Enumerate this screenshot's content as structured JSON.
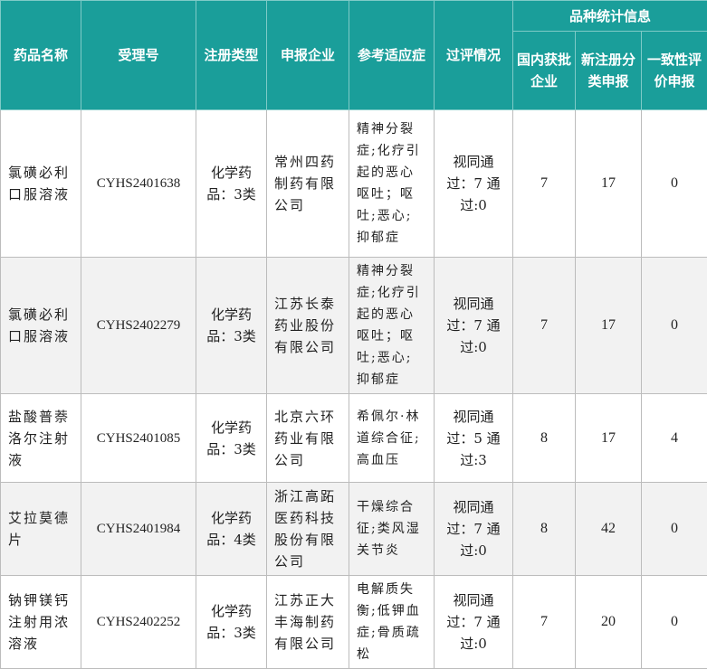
{
  "table": {
    "headers": {
      "drug_name": "药品名称",
      "acceptance_no": "受理号",
      "reg_type": "注册类型",
      "applicant": "申报企业",
      "indication": "参考适应症",
      "review": "过评情况",
      "stats_group": "品种统计信息",
      "domestic": "国内获批企业",
      "new_reg": "新注册分类申报",
      "consistency": "一致性评价申报"
    },
    "rows": [
      {
        "drug_name": "氯磺必利口服溶液",
        "acceptance_no": "CYHS2401638",
        "reg_type": "化学药品：3类",
        "applicant": "常州四药制药有限公司",
        "indication": "精神分裂症;化疗引起的恶心呕吐；呕吐;恶心;抑郁症",
        "review": "视同通过：7 通过:0",
        "domestic": "7",
        "new_reg": "17",
        "consistency": "0"
      },
      {
        "drug_name": "氯磺必利口服溶液",
        "acceptance_no": "CYHS2402279",
        "reg_type": "化学药品：3类",
        "applicant": "江苏长泰药业股份有限公司",
        "indication": "精神分裂症;化疗引起的恶心呕吐；呕吐;恶心;抑郁症",
        "review": "视同通过：7 通过:0",
        "domestic": "7",
        "new_reg": "17",
        "consistency": "0"
      },
      {
        "drug_name": "盐酸普萘洛尔注射液",
        "acceptance_no": "CYHS2401085",
        "reg_type": "化学药品：3类",
        "applicant": "北京六环药业有限公司",
        "indication": "希佩尔·林道综合征;高血压",
        "review": "视同通过：5 通过:3",
        "domestic": "8",
        "new_reg": "17",
        "consistency": "4"
      },
      {
        "drug_name": "艾拉莫德片",
        "acceptance_no": "CYHS2401984",
        "reg_type": "化学药品：4类",
        "applicant": "浙江高跖医药科技股份有限公司",
        "indication": "干燥综合征;类风湿关节炎",
        "review": "视同通过：7 通过:0",
        "domestic": "8",
        "new_reg": "42",
        "consistency": "0"
      },
      {
        "drug_name": "钠钾镁钙注射用浓溶液",
        "acceptance_no": "CYHS2402252",
        "reg_type": "化学药品：3类",
        "applicant": "江苏正大丰海制药有限公司",
        "indication": "电解质失衡;低钾血症;骨质疏松",
        "review": "视同通过：7 通过:0",
        "domestic": "7",
        "new_reg": "20",
        "consistency": "0"
      }
    ]
  }
}
